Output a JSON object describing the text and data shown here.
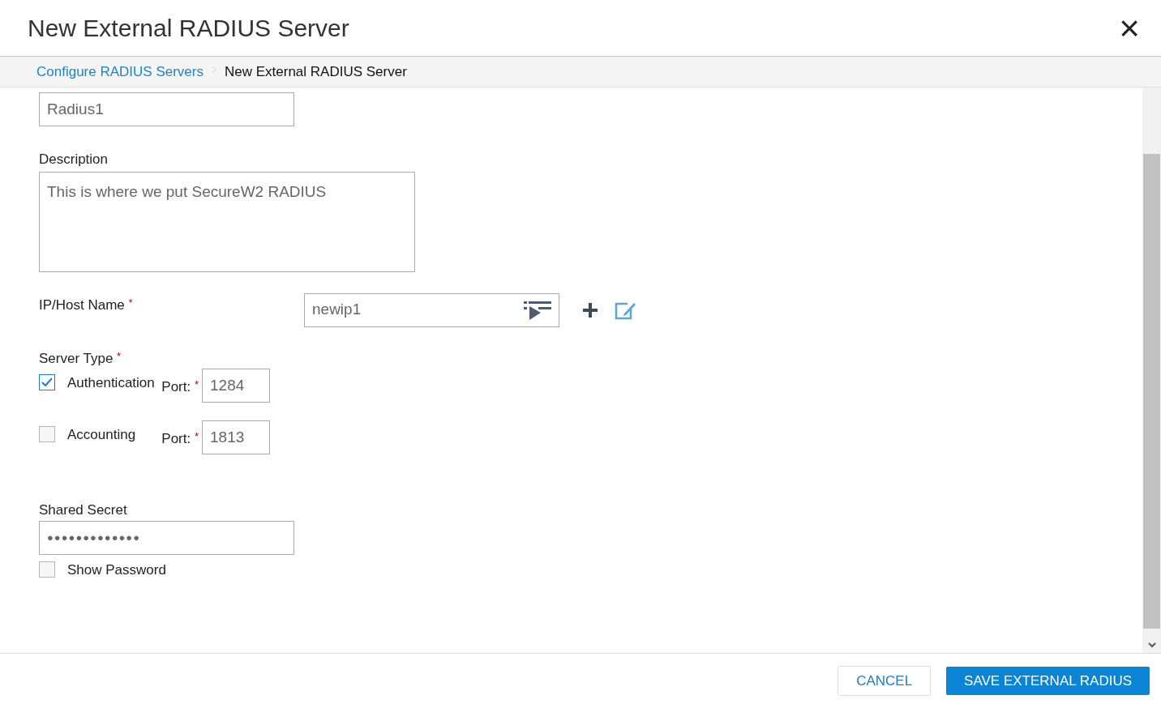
{
  "dialog": {
    "title": "New External RADIUS Server",
    "close": "×"
  },
  "breadcrumb": [
    {
      "label": "Configure RADIUS Servers",
      "link": true
    },
    {
      "label": "New External RADIUS Server",
      "link": false
    }
  ],
  "form": {
    "name_value": "Radius1",
    "description": {
      "label": "Description",
      "value": "This is where we put SecureW2 RADIUS"
    },
    "host": {
      "label": "IP/Host Name",
      "required": "*",
      "value": "newip1"
    },
    "server_type": {
      "label": "Server Type",
      "required": "*",
      "options": [
        {
          "label": "Authentication",
          "checked": true,
          "port_label": "Port:",
          "required": "*",
          "port": "1284"
        },
        {
          "label": "Accounting",
          "checked": false,
          "port_label": "Port:",
          "required": "*",
          "port": "1813"
        }
      ]
    },
    "secret": {
      "label": "Shared Secret",
      "value": "●●●●●●●●●●●●●"
    },
    "show_password": {
      "label": "Show Password",
      "checked": false
    }
  },
  "footer": {
    "buttons": [
      {
        "label": "CANCEL",
        "kind": "secondary"
      },
      {
        "label": "SAVE EXTERNAL RADIUS",
        "kind": "primary"
      }
    ]
  }
}
